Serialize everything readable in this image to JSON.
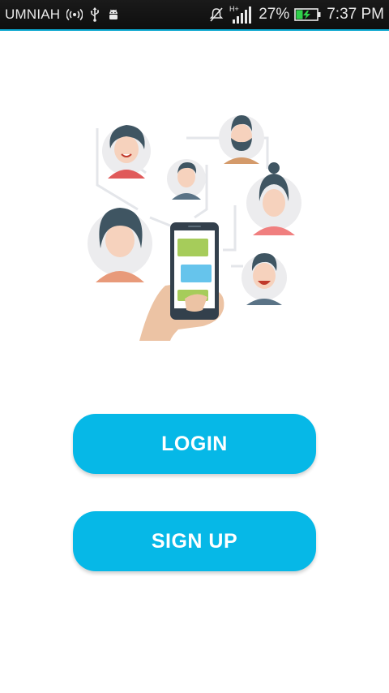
{
  "status_bar": {
    "carrier": "UMNIAH",
    "network_type": "H+",
    "battery_percent": "27%",
    "time": "7:37 PM",
    "icons": [
      "wifi-hotspot-icon",
      "usb-icon",
      "android-debug-icon",
      "mute-icon",
      "signal-icon",
      "battery-charging-icon"
    ]
  },
  "illustration": {
    "name": "chat-people-illustration"
  },
  "actions": {
    "login_label": "LOGIN",
    "signup_label": "SIGN UP"
  },
  "colors": {
    "accent": "#06b8e7",
    "statusbar": "#111111",
    "statusbar_border": "#0aa6cf"
  }
}
